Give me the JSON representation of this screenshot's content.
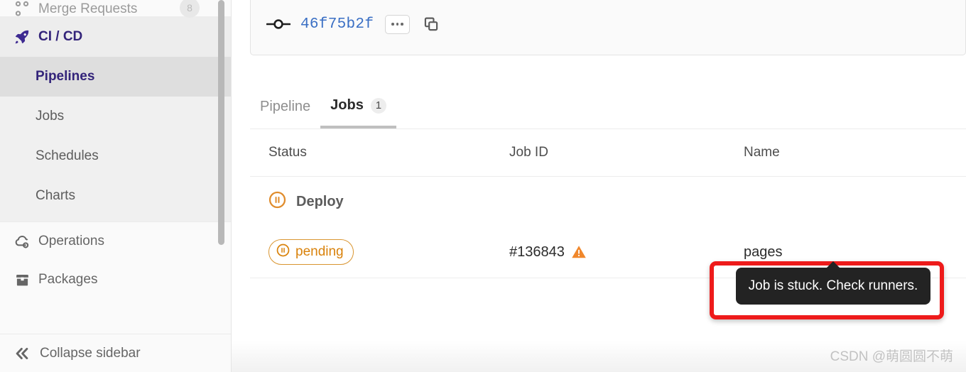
{
  "sidebar": {
    "merge_requests": {
      "label": "Merge Requests",
      "badge": "8",
      "icon": "merge-request-icon"
    },
    "cicd": {
      "label": "CI / CD",
      "icon": "rocket-icon"
    },
    "cicd_subitems": [
      {
        "label": "Pipelines",
        "active": true
      },
      {
        "label": "Jobs",
        "active": false
      },
      {
        "label": "Schedules",
        "active": false
      },
      {
        "label": "Charts",
        "active": false
      }
    ],
    "items": [
      {
        "label": "Operations",
        "icon": "cloud-gear-icon"
      },
      {
        "label": "Packages",
        "icon": "package-icon"
      }
    ],
    "collapse": {
      "label": "Collapse sidebar",
      "icon": "chevron-double-left-icon"
    }
  },
  "commit": {
    "sha": "46f75b2f",
    "node_icon": "commit-node-icon",
    "ellipsis_label": "",
    "ellipsis_icon": "ellipsis-icon",
    "copy_icon": "copy-icon"
  },
  "tabs": [
    {
      "label": "Pipeline",
      "active": false,
      "badge": ""
    },
    {
      "label": "Jobs",
      "active": true,
      "badge": "1"
    }
  ],
  "table": {
    "columns": {
      "status": "Status",
      "job_id": "Job ID",
      "name": "Name"
    },
    "stage": {
      "label": "Deploy",
      "icon": "pending-circle-icon"
    },
    "rows": [
      {
        "status": "pending",
        "status_icon": "pause-circle-icon",
        "job_id": "#136843",
        "warning_icon": "warning-triangle-icon",
        "name": "pages"
      }
    ]
  },
  "tooltip": {
    "text": "Job is stuck. Check runners."
  },
  "watermark": {
    "text": "CSDN @萌圆圆不萌"
  },
  "colors": {
    "gitlab_purple": "#33247a",
    "pending_orange": "#d9820b",
    "warning_orange": "#f0872b",
    "link_blue": "#3a6fc4",
    "highlight_red": "#ee1b1b",
    "tooltip_bg": "#232323"
  }
}
